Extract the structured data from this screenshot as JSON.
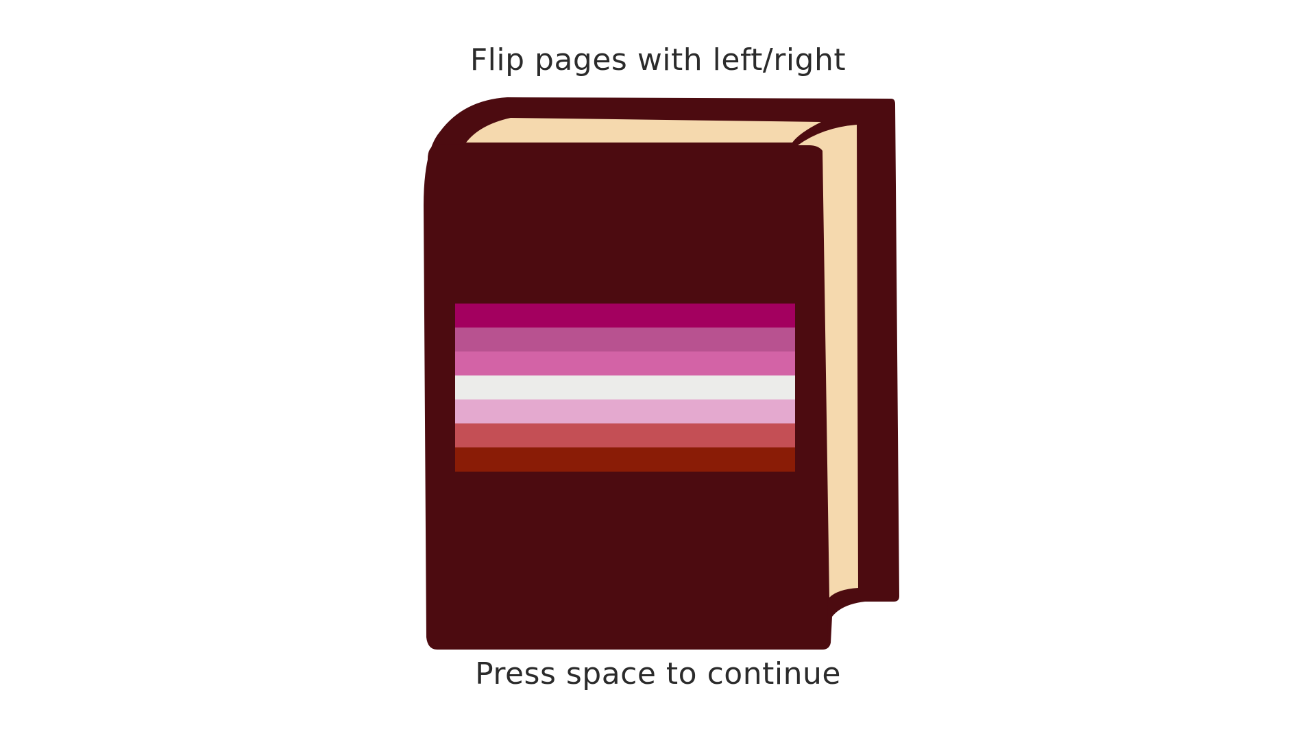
{
  "screen": {
    "top_hint": "Flip pages with left/right",
    "bottom_hint": "Press space to continue"
  },
  "book": {
    "icon": "closed-book-icon",
    "cover_color": "#4c0b10",
    "page_color": "#f5d9ae"
  },
  "flag": {
    "icon": "lesbian-pride-flag",
    "stripes": [
      "#a3005f",
      "#b85290",
      "#d363a6",
      "#ececea",
      "#e4a9cf",
      "#c44f55",
      "#8a1c06"
    ]
  }
}
